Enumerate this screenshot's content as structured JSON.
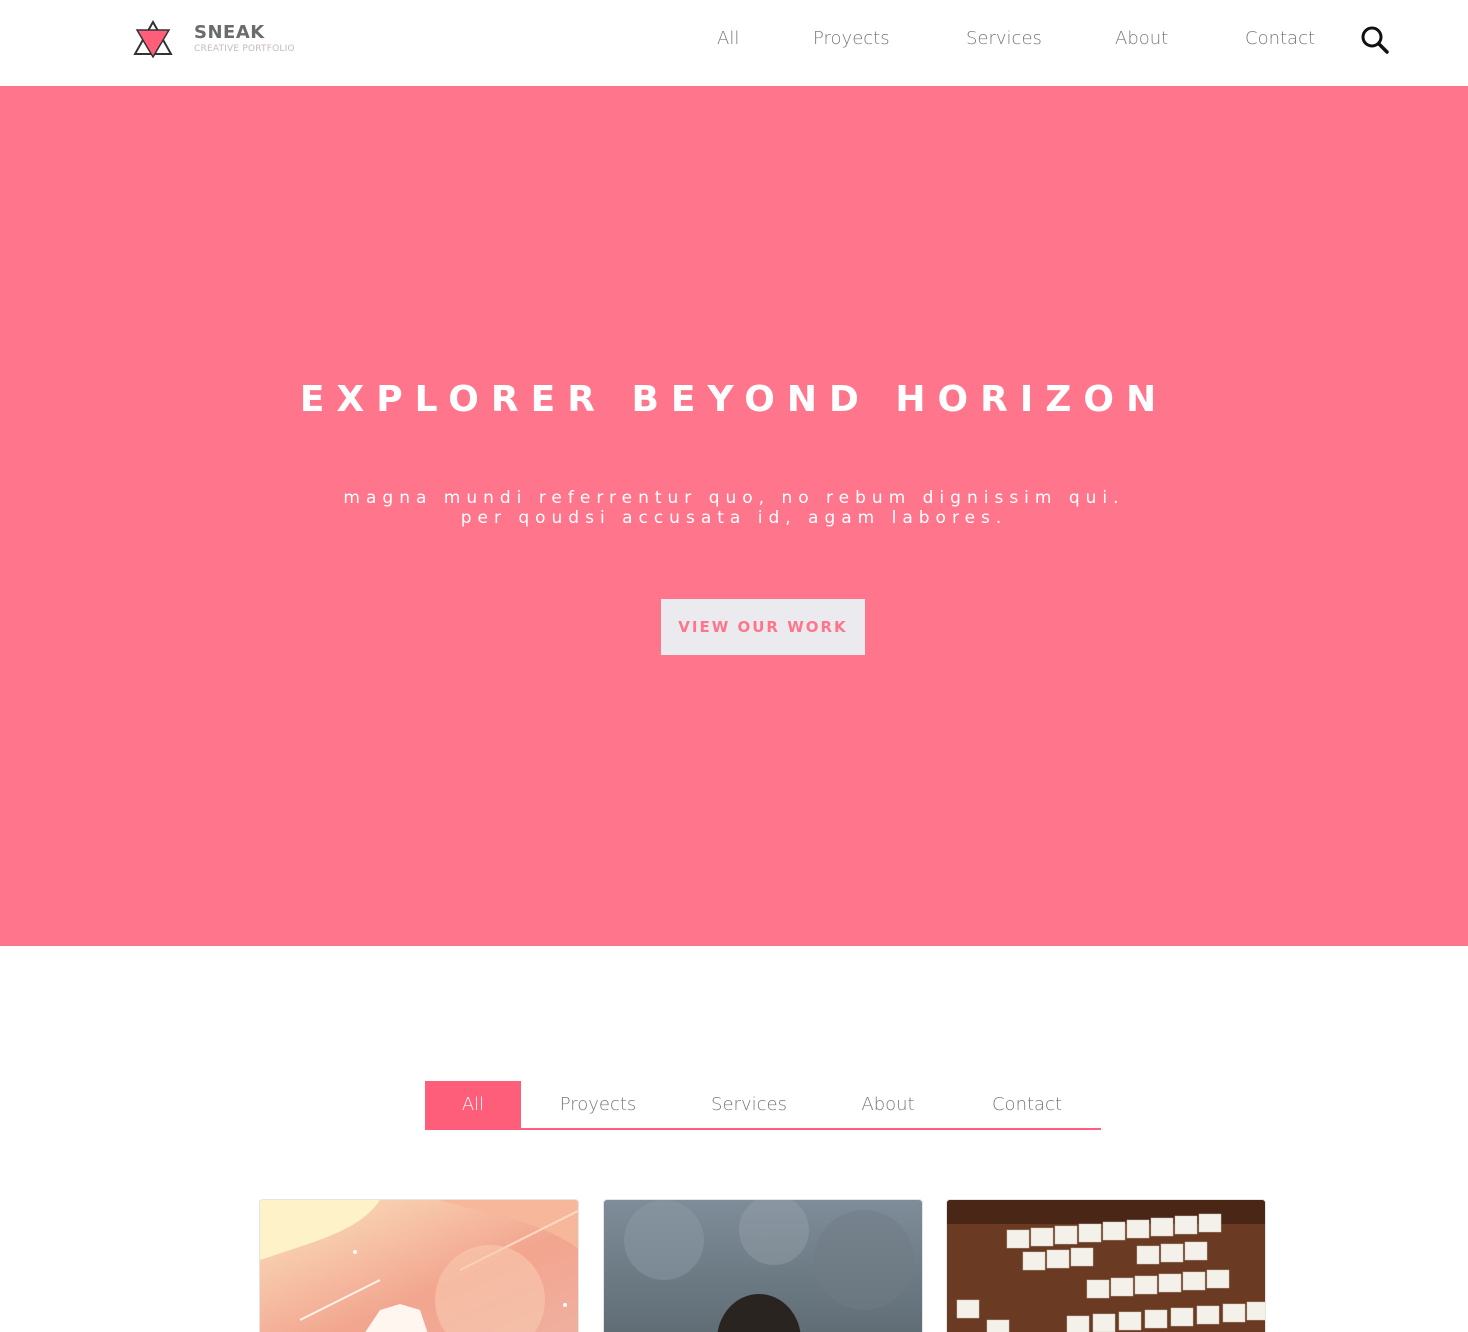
{
  "header": {
    "brand_name": "SNEAK",
    "brand_tagline": "CREATIVE PORTFOLIO",
    "nav": [
      "All",
      "Proyects",
      "Services",
      "About",
      "Contact"
    ]
  },
  "hero": {
    "title": "EXPLORER BEYOND HORIZON",
    "subtitle_line1": "magna mundi referrentur quo, no rebum dignissim qui.",
    "subtitle_line2": "per qoudsi accusata id, agam labores.",
    "cta_label": "VIEW OUR WORK"
  },
  "filters": {
    "items": [
      "All",
      "Proyects",
      "Services",
      "About",
      "Contact"
    ],
    "active": "All"
  },
  "portfolio": {
    "cards": [
      {
        "subject": "illustration"
      },
      {
        "subject": "person"
      },
      {
        "subject": "scrabble-tiles"
      }
    ]
  },
  "colors": {
    "accent": "#ff758c",
    "accent_dark": "#ff5e7a",
    "hero_button_bg": "#ebebef"
  }
}
